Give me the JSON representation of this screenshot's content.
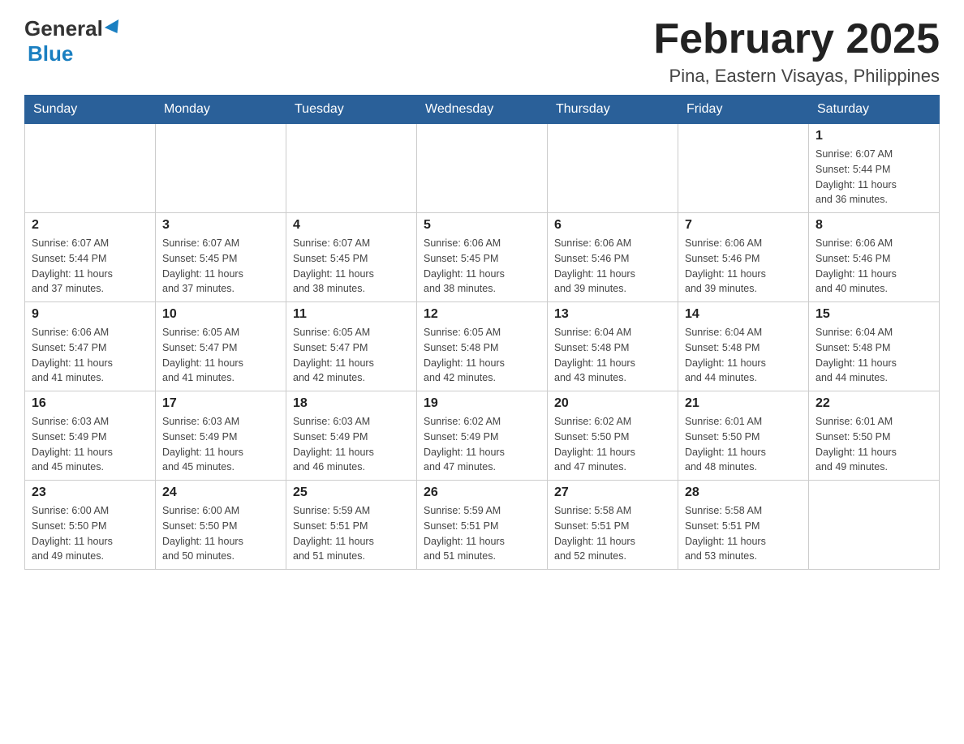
{
  "logo": {
    "general": "General",
    "blue": "Blue"
  },
  "title": {
    "month": "February 2025",
    "location": "Pina, Eastern Visayas, Philippines"
  },
  "weekdays": [
    "Sunday",
    "Monday",
    "Tuesday",
    "Wednesday",
    "Thursday",
    "Friday",
    "Saturday"
  ],
  "weeks": [
    [
      {
        "day": "",
        "info": ""
      },
      {
        "day": "",
        "info": ""
      },
      {
        "day": "",
        "info": ""
      },
      {
        "day": "",
        "info": ""
      },
      {
        "day": "",
        "info": ""
      },
      {
        "day": "",
        "info": ""
      },
      {
        "day": "1",
        "info": "Sunrise: 6:07 AM\nSunset: 5:44 PM\nDaylight: 11 hours\nand 36 minutes."
      }
    ],
    [
      {
        "day": "2",
        "info": "Sunrise: 6:07 AM\nSunset: 5:44 PM\nDaylight: 11 hours\nand 37 minutes."
      },
      {
        "day": "3",
        "info": "Sunrise: 6:07 AM\nSunset: 5:45 PM\nDaylight: 11 hours\nand 37 minutes."
      },
      {
        "day": "4",
        "info": "Sunrise: 6:07 AM\nSunset: 5:45 PM\nDaylight: 11 hours\nand 38 minutes."
      },
      {
        "day": "5",
        "info": "Sunrise: 6:06 AM\nSunset: 5:45 PM\nDaylight: 11 hours\nand 38 minutes."
      },
      {
        "day": "6",
        "info": "Sunrise: 6:06 AM\nSunset: 5:46 PM\nDaylight: 11 hours\nand 39 minutes."
      },
      {
        "day": "7",
        "info": "Sunrise: 6:06 AM\nSunset: 5:46 PM\nDaylight: 11 hours\nand 39 minutes."
      },
      {
        "day": "8",
        "info": "Sunrise: 6:06 AM\nSunset: 5:46 PM\nDaylight: 11 hours\nand 40 minutes."
      }
    ],
    [
      {
        "day": "9",
        "info": "Sunrise: 6:06 AM\nSunset: 5:47 PM\nDaylight: 11 hours\nand 41 minutes."
      },
      {
        "day": "10",
        "info": "Sunrise: 6:05 AM\nSunset: 5:47 PM\nDaylight: 11 hours\nand 41 minutes."
      },
      {
        "day": "11",
        "info": "Sunrise: 6:05 AM\nSunset: 5:47 PM\nDaylight: 11 hours\nand 42 minutes."
      },
      {
        "day": "12",
        "info": "Sunrise: 6:05 AM\nSunset: 5:48 PM\nDaylight: 11 hours\nand 42 minutes."
      },
      {
        "day": "13",
        "info": "Sunrise: 6:04 AM\nSunset: 5:48 PM\nDaylight: 11 hours\nand 43 minutes."
      },
      {
        "day": "14",
        "info": "Sunrise: 6:04 AM\nSunset: 5:48 PM\nDaylight: 11 hours\nand 44 minutes."
      },
      {
        "day": "15",
        "info": "Sunrise: 6:04 AM\nSunset: 5:48 PM\nDaylight: 11 hours\nand 44 minutes."
      }
    ],
    [
      {
        "day": "16",
        "info": "Sunrise: 6:03 AM\nSunset: 5:49 PM\nDaylight: 11 hours\nand 45 minutes."
      },
      {
        "day": "17",
        "info": "Sunrise: 6:03 AM\nSunset: 5:49 PM\nDaylight: 11 hours\nand 45 minutes."
      },
      {
        "day": "18",
        "info": "Sunrise: 6:03 AM\nSunset: 5:49 PM\nDaylight: 11 hours\nand 46 minutes."
      },
      {
        "day": "19",
        "info": "Sunrise: 6:02 AM\nSunset: 5:49 PM\nDaylight: 11 hours\nand 47 minutes."
      },
      {
        "day": "20",
        "info": "Sunrise: 6:02 AM\nSunset: 5:50 PM\nDaylight: 11 hours\nand 47 minutes."
      },
      {
        "day": "21",
        "info": "Sunrise: 6:01 AM\nSunset: 5:50 PM\nDaylight: 11 hours\nand 48 minutes."
      },
      {
        "day": "22",
        "info": "Sunrise: 6:01 AM\nSunset: 5:50 PM\nDaylight: 11 hours\nand 49 minutes."
      }
    ],
    [
      {
        "day": "23",
        "info": "Sunrise: 6:00 AM\nSunset: 5:50 PM\nDaylight: 11 hours\nand 49 minutes."
      },
      {
        "day": "24",
        "info": "Sunrise: 6:00 AM\nSunset: 5:50 PM\nDaylight: 11 hours\nand 50 minutes."
      },
      {
        "day": "25",
        "info": "Sunrise: 5:59 AM\nSunset: 5:51 PM\nDaylight: 11 hours\nand 51 minutes."
      },
      {
        "day": "26",
        "info": "Sunrise: 5:59 AM\nSunset: 5:51 PM\nDaylight: 11 hours\nand 51 minutes."
      },
      {
        "day": "27",
        "info": "Sunrise: 5:58 AM\nSunset: 5:51 PM\nDaylight: 11 hours\nand 52 minutes."
      },
      {
        "day": "28",
        "info": "Sunrise: 5:58 AM\nSunset: 5:51 PM\nDaylight: 11 hours\nand 53 minutes."
      },
      {
        "day": "",
        "info": ""
      }
    ]
  ]
}
